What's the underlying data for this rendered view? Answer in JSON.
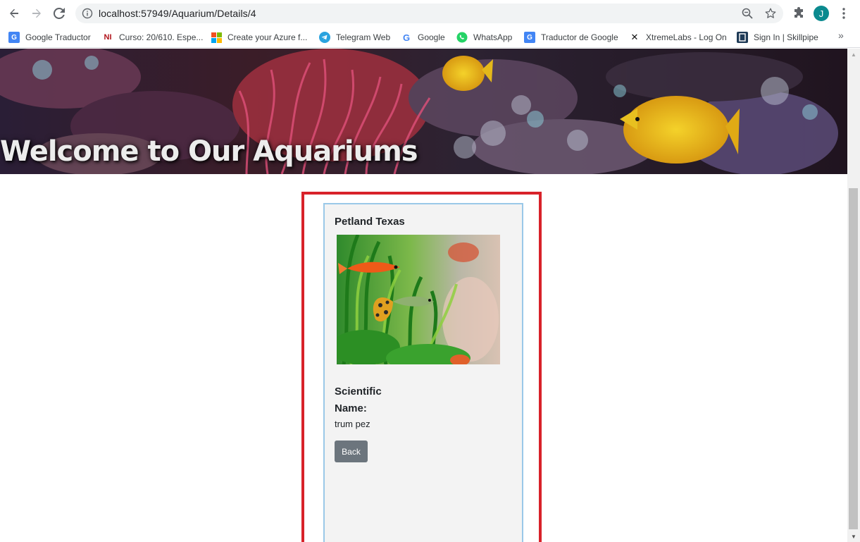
{
  "browser": {
    "url": "localhost:57949/Aquarium/Details/4",
    "avatar_letter": "J",
    "bookmarks": [
      {
        "label": "Google Traductor",
        "icon": "google-translate-icon"
      },
      {
        "label": "Curso: 20/610. Espe...",
        "icon": "ni-icon"
      },
      {
        "label": "Create your Azure f...",
        "icon": "microsoft-icon"
      },
      {
        "label": "Telegram Web",
        "icon": "telegram-icon"
      },
      {
        "label": "Google",
        "icon": "google-icon"
      },
      {
        "label": "WhatsApp",
        "icon": "whatsapp-icon"
      },
      {
        "label": "Traductor de Google",
        "icon": "google-translate-icon"
      },
      {
        "label": "XtremeLabs - Log On",
        "icon": "xtremelabs-icon"
      },
      {
        "label": "Sign In | Skillpipe",
        "icon": "skillpipe-icon"
      }
    ],
    "more_glyph": "»"
  },
  "page": {
    "banner_title": "Welcome to Our Aquariums",
    "card": {
      "title": "Petland Texas",
      "scientific_name_label": "Scientific Name:",
      "scientific_name_value": "trum pez",
      "back_label": "Back"
    }
  },
  "colors": {
    "frame_red": "#d8222a",
    "card_border": "#9ac8e8",
    "card_bg": "#f3f3f3",
    "button_grey": "#6c757d"
  }
}
